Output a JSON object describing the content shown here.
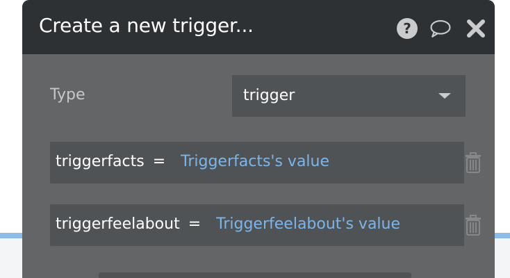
{
  "modal": {
    "title": "Create a new trigger...",
    "header_icons": [
      "help-icon",
      "comment-icon",
      "close-icon"
    ]
  },
  "type_field": {
    "label": "Type",
    "selected": "trigger"
  },
  "fields": [
    {
      "name": "triggerfacts",
      "operator": "=",
      "value": "Triggerfacts's value"
    },
    {
      "name": "triggerfeelabout",
      "operator": "=",
      "value": "Triggerfeelabout's value"
    }
  ],
  "colors": {
    "header_bg": "#2e3133",
    "modal_bg": "#636567",
    "field_bg": "#505355",
    "value_link": "#7db5ea",
    "accent_line": "#8fbde6"
  }
}
